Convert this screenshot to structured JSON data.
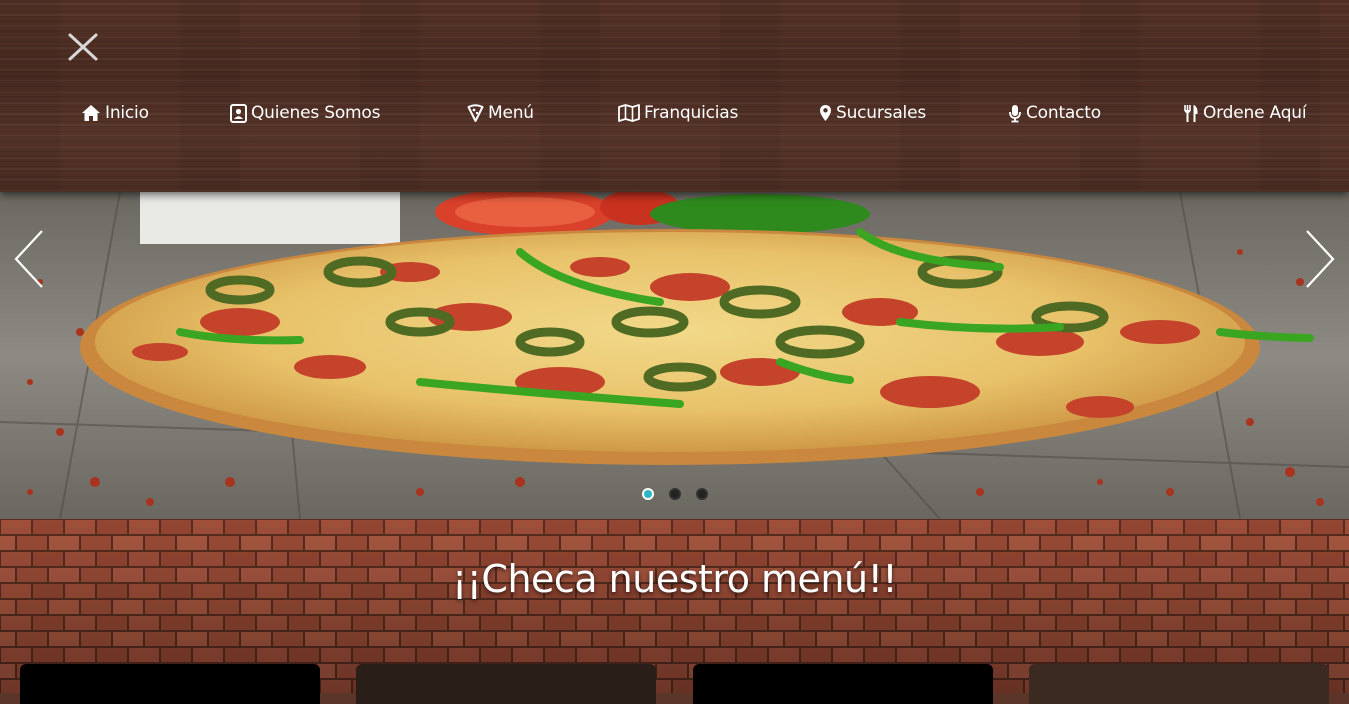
{
  "header": {
    "close_icon": "close-icon",
    "nav": [
      {
        "label": "Inicio",
        "icon": "home-icon"
      },
      {
        "label": "Quienes Somos",
        "icon": "contact-card-icon"
      },
      {
        "label": "Menú",
        "icon": "pizza-slice-icon"
      },
      {
        "label": "Franquicias",
        "icon": "map-icon"
      },
      {
        "label": "Sucursales",
        "icon": "map-marker-icon"
      },
      {
        "label": "Contacto",
        "icon": "microphone-icon"
      },
      {
        "label": "Ordene Aquí",
        "icon": "cutlery-icon"
      }
    ]
  },
  "carousel": {
    "slide_count": 3,
    "active_index": 0,
    "prev_icon": "chevron-left-icon",
    "next_icon": "chevron-right-icon"
  },
  "menu_section": {
    "title": "¡¡Checa nuestro menú!!",
    "card_count": 4
  },
  "colors": {
    "wood": "#4e2e23",
    "brick": "#a8533d",
    "mortar": "#5b2f22",
    "dot_active": "#2bb7c8",
    "nav_text": "#ffffff"
  }
}
